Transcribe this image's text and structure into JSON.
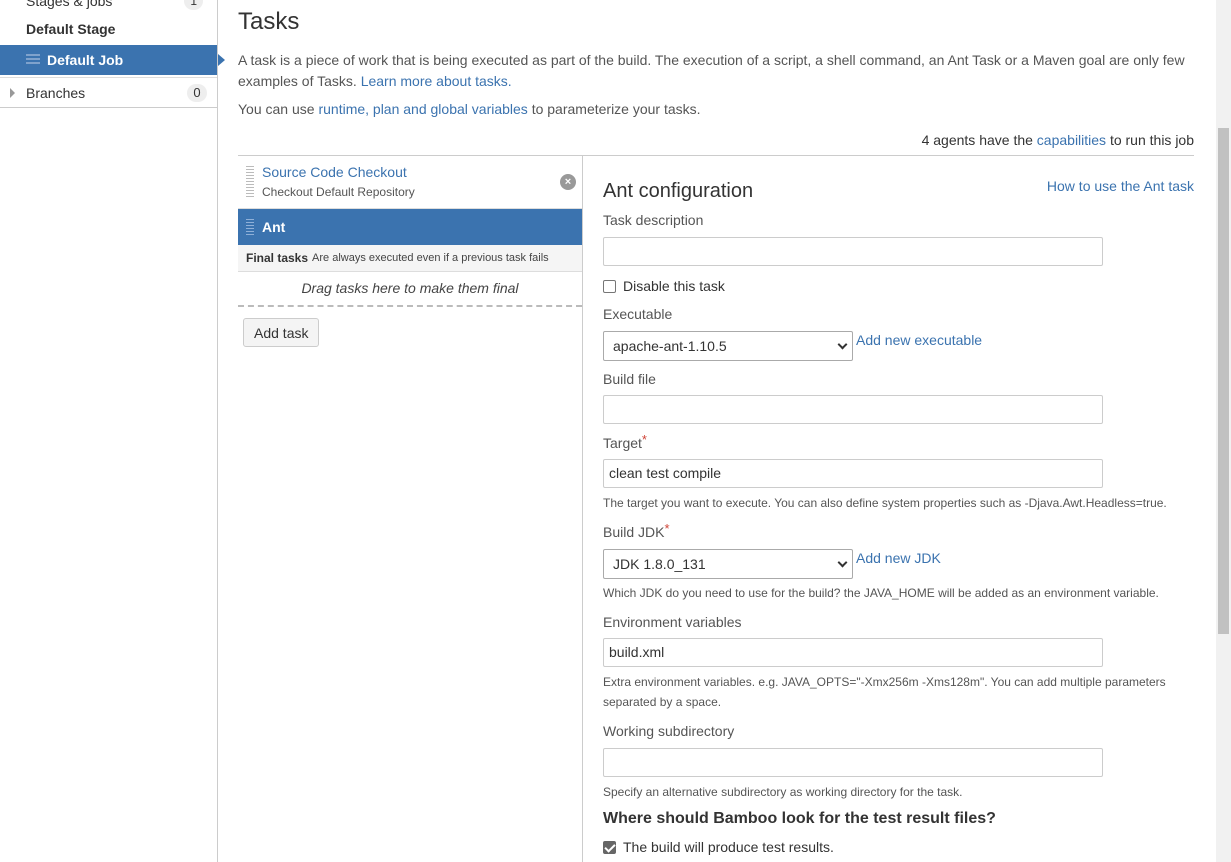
{
  "sidebar": {
    "stages_label": "Stages & jobs",
    "stages_count": "1",
    "stage_label": "Default Stage",
    "job_label": "Default Job",
    "branches_label": "Branches",
    "branches_count": "0"
  },
  "header": {
    "title": "Tasks",
    "desc_text": "A task is a piece of work that is being executed as part of the build. The execution of a script, a shell command, an Ant Task or a Maven goal are only few examples of Tasks. ",
    "desc_link": "Learn more about tasks.",
    "vars_prefix": "You can use ",
    "vars_link": "runtime, plan and global variables",
    "vars_suffix": " to parameterize your tasks.",
    "agents_prefix": "4 agents have the ",
    "agents_link": "capabilities",
    "agents_suffix": " to run this job"
  },
  "tasks": {
    "source_name": "Source Code Checkout",
    "source_sub": "Checkout Default Repository",
    "remove_glyph": "×",
    "ant_name": "Ant",
    "final_label": "Final tasks",
    "final_sub": "Are always executed even if a previous task fails",
    "drop_text": "Drag tasks here to make them final",
    "add_task": "Add task"
  },
  "config": {
    "title": "Ant configuration",
    "help_link": "How to use the Ant task",
    "task_desc_label": "Task description",
    "task_desc_value": "",
    "disable_label": "Disable this task",
    "disable_checked": false,
    "executable_label": "Executable",
    "executable_value": "apache-ant-1.10.5",
    "add_executable": "Add new executable",
    "build_file_label": "Build file",
    "build_file_value": "",
    "target_label": "Target",
    "required_mark": "*",
    "target_value": "clean test compile",
    "target_hint": "The target you want to execute. You can also define system properties such as -Djava.Awt.Headless=true.",
    "jdk_label": "Build JDK",
    "jdk_value": "JDK 1.8.0_131",
    "add_jdk": "Add new JDK",
    "jdk_hint": "Which JDK do you need to use for the build? the JAVA_HOME will be added as an environment variable.",
    "env_label": "Environment variables",
    "env_value": "build.xml",
    "env_hint": "Extra environment variables. e.g. JAVA_OPTS=\"-Xmx256m -Xms128m\". You can add multiple parameters separated by a space.",
    "workdir_label": "Working subdirectory",
    "workdir_value": "",
    "workdir_hint": "Specify an alternative subdirectory as working directory for the task.",
    "test_heading": "Where should Bamboo look for the test result files?",
    "test_label": "The build will produce test results.",
    "test_checked": true
  },
  "colors": {
    "accent": "#3b73af",
    "required": "#d04437"
  }
}
